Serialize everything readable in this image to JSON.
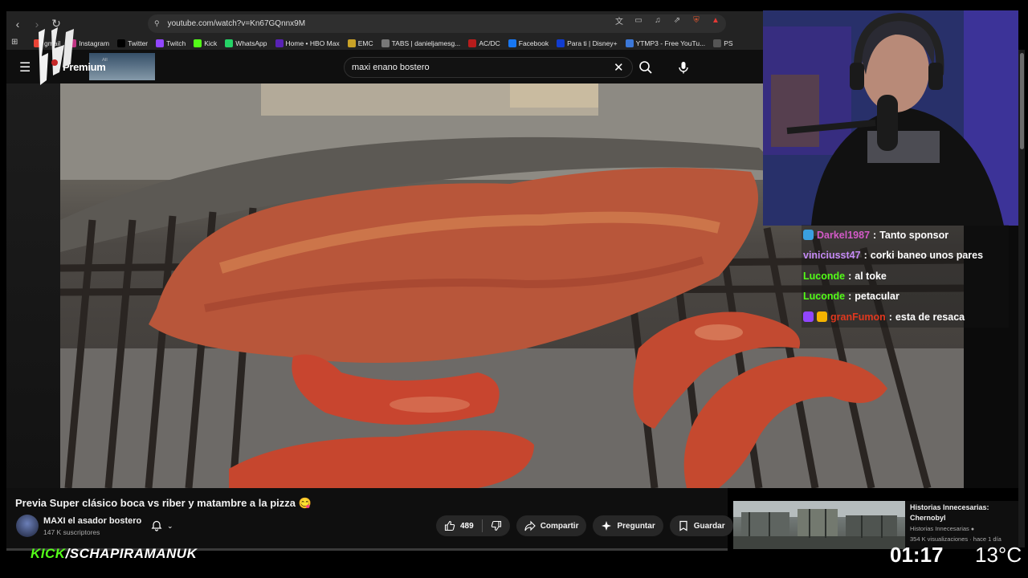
{
  "browser": {
    "url": "youtube.com/watch?v=Kn67GQnnx9M",
    "bookmarks": [
      {
        "label": "gmail",
        "color": "#ea4335"
      },
      {
        "label": "Instagram",
        "color": "#c13584"
      },
      {
        "label": "Twitter",
        "color": "#000000"
      },
      {
        "label": "Twitch",
        "color": "#9146ff"
      },
      {
        "label": "Kick",
        "color": "#53fc18"
      },
      {
        "label": "WhatsApp",
        "color": "#25d366"
      },
      {
        "label": "Home • HBO Max",
        "color": "#5822b4"
      },
      {
        "label": "EMC",
        "color": "#c9a227"
      },
      {
        "label": "TABS | danieljamesg...",
        "color": "#777777"
      },
      {
        "label": "AC/DC",
        "color": "#b71c1c"
      },
      {
        "label": "Facebook",
        "color": "#1877f2"
      },
      {
        "label": "Para ti | Disney+",
        "color": "#113ccf"
      },
      {
        "label": "YTMP3 - Free YouTu...",
        "color": "#3c78d8"
      },
      {
        "label": "PS",
        "color": "#555555"
      }
    ]
  },
  "youtube": {
    "premium_label": "Premium",
    "mini_thumb_label": "All",
    "search_query": "maxi enano bostero"
  },
  "video": {
    "title": "Previa Super clásico boca vs riber y matambre a la pizza 😋",
    "channel_name": "MAXI el asador bostero",
    "subscribers": "147 K suscriptores",
    "likes": "489",
    "share_label": "Compartir",
    "ask_label": "Preguntar",
    "save_label": "Guardar",
    "more_label": "···"
  },
  "recommendation": {
    "title": "Historias Innecesarias: Chernobyl",
    "channel": "Historias Innecesarias",
    "meta": "354 K visualizaciones · hace 1 día"
  },
  "chat": [
    {
      "user": "Darkel1987",
      "message": "Tanto sponsor",
      "user_color": "#d35ac8",
      "badges": [
        "#3aa0e0"
      ]
    },
    {
      "user": "viniciusst47",
      "message": "corki baneo unos pares",
      "user_color": "#c58af5",
      "badges": []
    },
    {
      "user": "Luconde",
      "message": "al toke",
      "user_color": "#53fc18",
      "badges": []
    },
    {
      "user": "Luconde",
      "message": "petacular",
      "user_color": "#53fc18",
      "badges": []
    },
    {
      "user": "granFumon",
      "message": "esta de resaca",
      "user_color": "#e0381e",
      "badges": [
        "#9146ff",
        "#f5b400"
      ]
    }
  ],
  "overlay": {
    "kick_word": "KICK",
    "kick_user": "/SCHAPIRAMANUK",
    "clock": "01:17",
    "temperature": "13°C"
  }
}
